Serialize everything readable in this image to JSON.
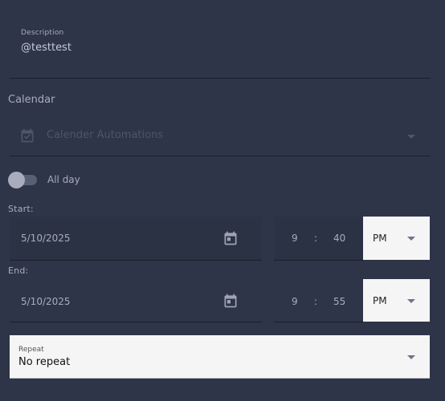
{
  "description": {
    "label": "Description",
    "value": "@testtest"
  },
  "calendar": {
    "section_label": "Calendar",
    "selected": "Calender Automations"
  },
  "all_day": {
    "label": "All day",
    "checked": false
  },
  "start": {
    "label": "Start:",
    "date": "5/10/2025",
    "hour": "9",
    "separator": ":",
    "minute": "40",
    "ampm": "PM"
  },
  "end": {
    "label": "End:",
    "date": "5/10/2025",
    "hour": "9",
    "separator": ":",
    "minute": "55",
    "ampm": "PM"
  },
  "repeat": {
    "label": "Repeat",
    "value": "No repeat"
  },
  "colors": {
    "background": "#2e3548",
    "field_bg": "#2b3244",
    "light_field": "#f5f5f5",
    "text": "#a8acbd"
  }
}
